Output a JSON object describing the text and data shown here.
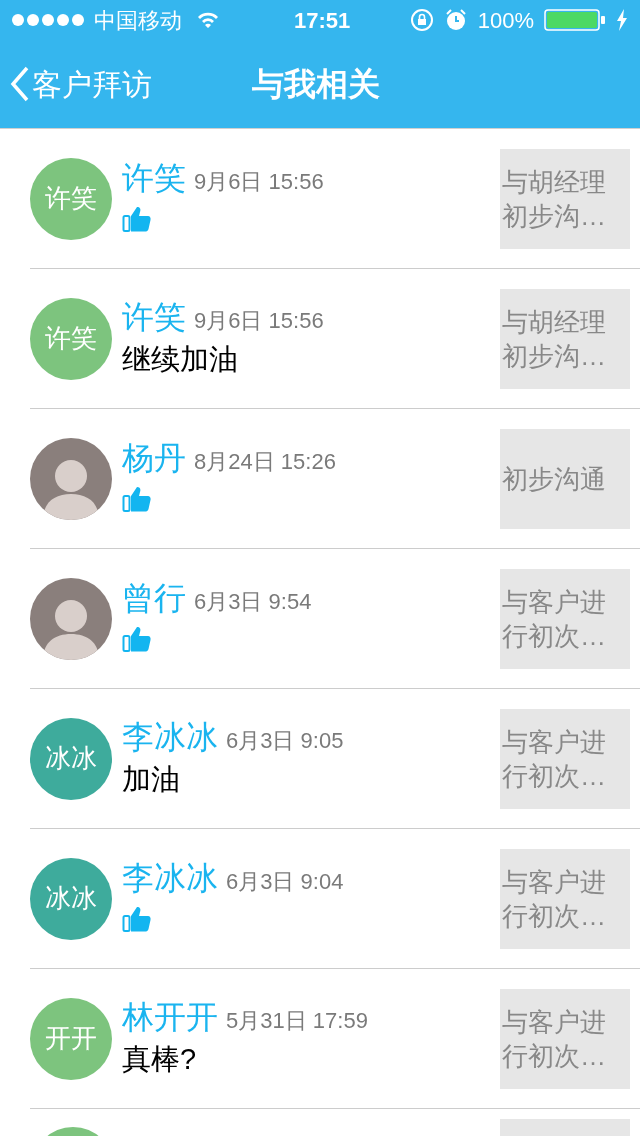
{
  "status_bar": {
    "carrier": "中国移动",
    "time": "17:51",
    "battery": "100%"
  },
  "nav": {
    "back": "客户拜访",
    "title": "与我相关"
  },
  "items": [
    {
      "kind": "like",
      "avatar": {
        "kind": "initials",
        "label": "许笑",
        "color": "#7dc47e"
      },
      "name": "许笑",
      "time": "9月6日 15:56",
      "thumbnail": "与胡经理初步沟…"
    },
    {
      "kind": "comment",
      "avatar": {
        "kind": "initials",
        "label": "许笑",
        "color": "#7dc47e"
      },
      "name": "许笑",
      "time": "9月6日 15:56",
      "comment": "继续加油",
      "thumbnail": "与胡经理初步沟…"
    },
    {
      "kind": "like",
      "avatar": {
        "kind": "photo"
      },
      "name": "杨丹",
      "time": "8月24日 15:26",
      "thumbnail": "初步沟通"
    },
    {
      "kind": "like",
      "avatar": {
        "kind": "photo"
      },
      "name": "曾行",
      "time": "6月3日 9:54",
      "thumbnail": "与客户进行初次…"
    },
    {
      "kind": "comment",
      "avatar": {
        "kind": "initials",
        "label": "冰冰",
        "color": "#3eab9c"
      },
      "name": "李冰冰",
      "time": "6月3日 9:05",
      "comment": "加油",
      "thumbnail": "与客户进行初次…"
    },
    {
      "kind": "like",
      "avatar": {
        "kind": "initials",
        "label": "冰冰",
        "color": "#3eab9c"
      },
      "name": "李冰冰",
      "time": "6月3日 9:04",
      "thumbnail": "与客户进行初次…"
    },
    {
      "kind": "comment",
      "avatar": {
        "kind": "initials",
        "label": "开开",
        "color": "#7dc47e"
      },
      "name": "林开开",
      "time": "5月31日 17:59",
      "comment": "真棒?",
      "thumbnail": "与客户进行初次…"
    },
    {
      "kind": "partial",
      "avatar": {
        "kind": "initials",
        "color": "#7dc47e"
      }
    }
  ]
}
